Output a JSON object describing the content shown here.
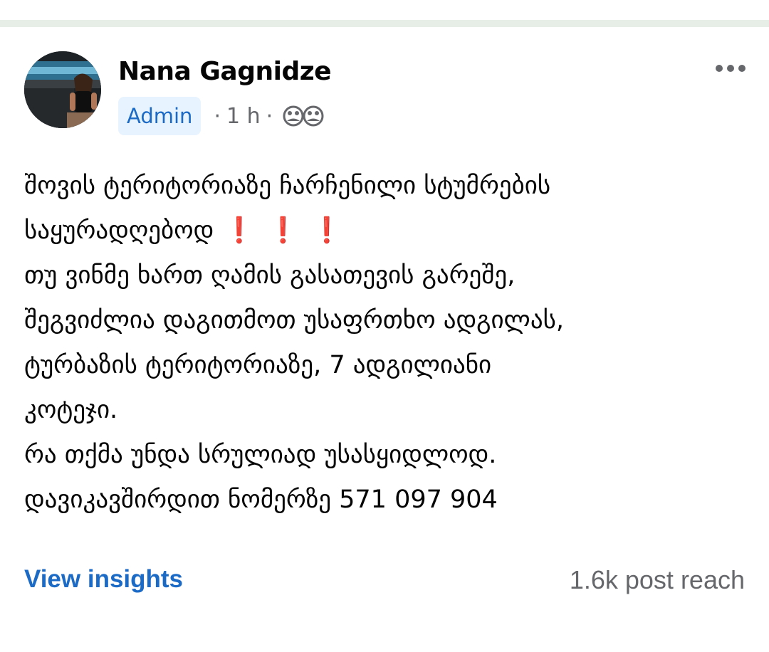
{
  "post": {
    "author": "Nana Gagnidze",
    "badge": "Admin",
    "time": "1 h",
    "separator": "·",
    "audience_icon": "groups-icon",
    "more_icon": "more-horizontal-icon",
    "body_lines": [
      "შოვის ტერიტორიაზე ჩარჩენილი სტუმრების",
      "საყურადღებოდ",
      "თუ ვინმე ხართ ღამის გასათევის გარეშე,",
      "შეგვიძლია დაგითმოთ უსაფრთხო ადგილას,",
      "ტურბაზის ტერიტორიაზე, 7 ადგილიანი",
      "კოტეჯი.",
      "რა თქმა უნდა სრულიად უსასყიდლოდ.",
      "დავიკავშირდით ნომერზე  571 097 904"
    ],
    "alert_marks": "❗❗❗"
  },
  "footer": {
    "insights_label": "View insights",
    "reach_label": "1.6k post reach"
  },
  "colors": {
    "link": "#1b6ac6",
    "badge_bg": "#e7f3ff",
    "muted": "#65676b",
    "alert": "#e02a2a"
  }
}
